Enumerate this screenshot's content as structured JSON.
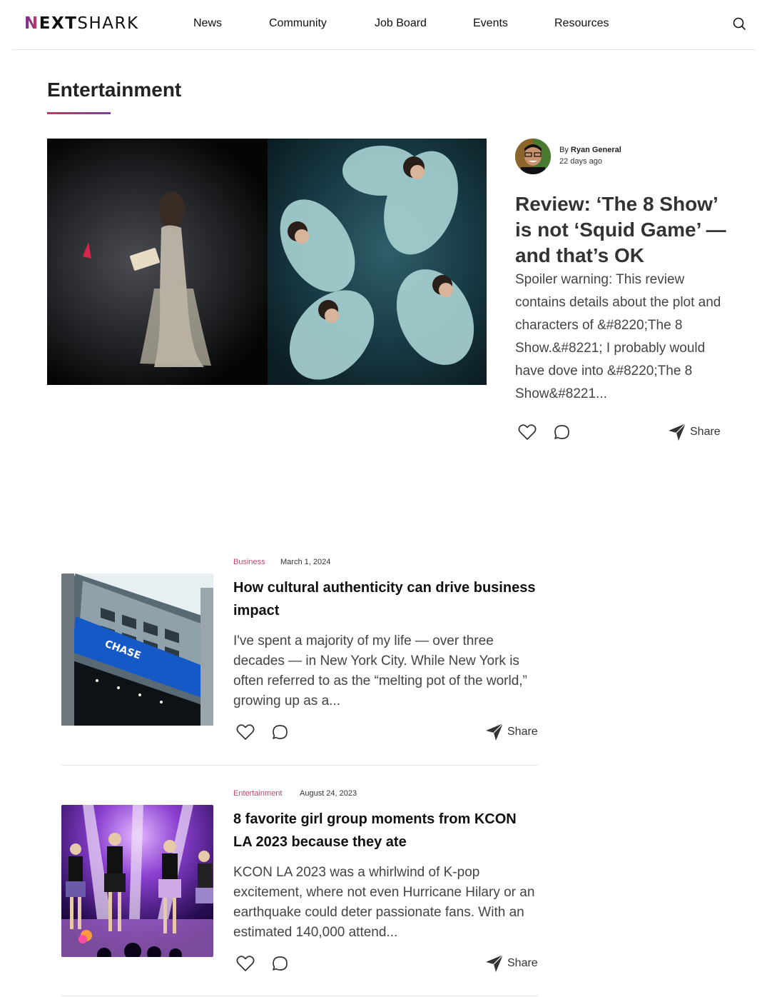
{
  "header": {
    "logo": {
      "first": "N",
      "middle": "EXT",
      "last": "SHARK"
    },
    "nav": [
      {
        "label": "News"
      },
      {
        "label": "Community"
      },
      {
        "label": "Job Board"
      },
      {
        "label": "Events"
      },
      {
        "label": "Resources"
      }
    ],
    "search_icon": "search-icon"
  },
  "section": {
    "title": "Entertainment"
  },
  "featured": {
    "author_prefix": "By",
    "author": "Ryan General",
    "time": "22 days ago",
    "title": "Review: ‘The 8 Show’ is not ‘Squid Game’ — and that’s OK",
    "excerpt": "Spoiler warning: This review contains details about the plot and characters of &#8220;The 8 Show.&#8221; I probably would have dove into &#8220;The 8 Show&#8221...",
    "share_label": "Share"
  },
  "articles": [
    {
      "category": "Business",
      "date": "March 1, 2024",
      "title": "How cultural authenticity can drive business impact",
      "excerpt": "I've spent a majority of my life — over three decades — in New York City. While New York is often referred to as the “melting pot of the world,” growing up as a...",
      "share_label": "Share",
      "sign_text": "CHASE"
    },
    {
      "category": "Entertainment",
      "date": "August 24, 2023",
      "title": "8 favorite girl group moments from KCON LA 2023 because they ate",
      "excerpt": "KCON LA 2023 was a whirlwind of K-pop excitement, where not even Hurricane Hilary or an earthquake could deter passionate fans. With an estimated 140,000 attend...",
      "share_label": "Share"
    }
  ],
  "colors": {
    "accent_start": "#c73a5a",
    "accent_end": "#7b3fa0",
    "category": "#c0466a"
  }
}
